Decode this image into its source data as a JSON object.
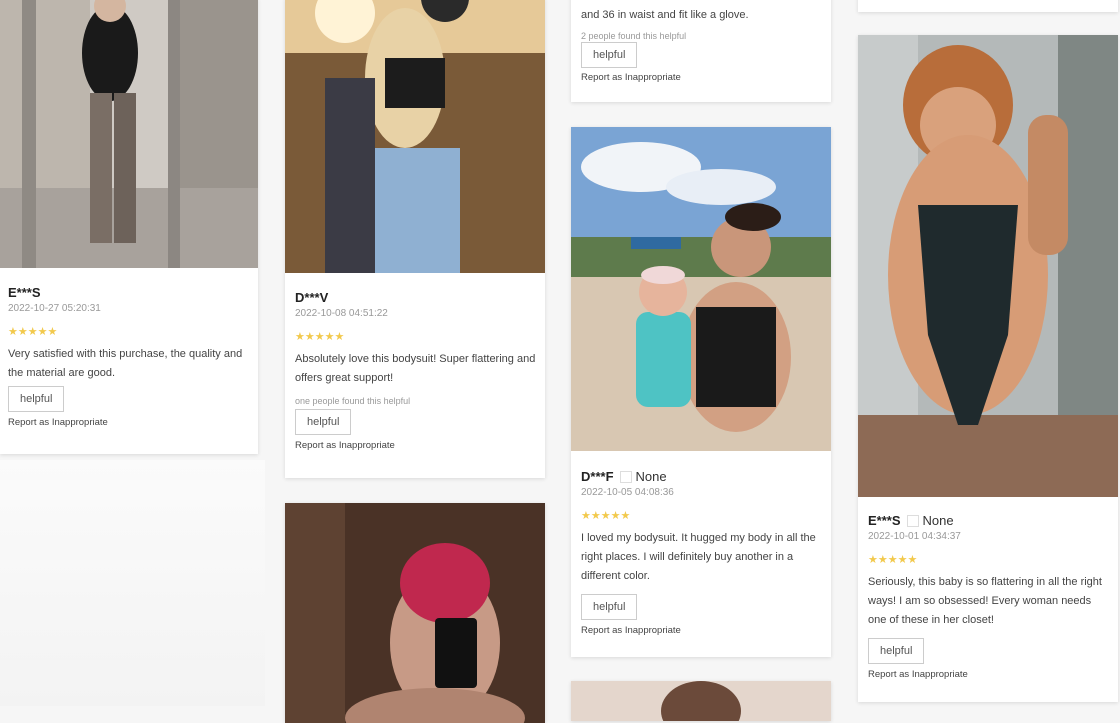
{
  "cards": [
    {
      "name": "E***S",
      "date": "2022-10-27 05:20:31",
      "stars": "★★★★★",
      "text": "Very satisfied with this purchase, the quality and the material are good.",
      "helpful": "helpful",
      "report": "Report as Inappropriate"
    },
    {
      "name": "D***V",
      "date": "2022-10-08 04:51:22",
      "stars": "★★★★★",
      "text": "Absolutely love this bodysuit! Super flattering and offers great support!",
      "found": "one people found this helpful",
      "helpful": "helpful",
      "report": "Report as Inappropriate"
    },
    {
      "text_tail": "and 36 in waist and fit like a glove.",
      "found": "2 people found this helpful",
      "helpful": "helpful",
      "report": "Report as Inappropriate"
    },
    {
      "name": "D***F",
      "tag": "None",
      "date": "2022-10-05 04:08:36",
      "stars": "★★★★★",
      "text": "I loved my bodysuit. It hugged my body in all the right places. I will definitely buy another in a different color.",
      "helpful": "helpful",
      "report": "Report as Inappropriate"
    },
    {
      "name": "E***S",
      "tag": "None",
      "date": "2022-10-01 04:34:37",
      "stars": "★★★★★",
      "text": "Seriously, this baby is so flattering in all the right ways! I am so obsessed! Every woman needs one of these in her closet!",
      "helpful": "helpful",
      "report": "Report as Inappropriate"
    }
  ]
}
